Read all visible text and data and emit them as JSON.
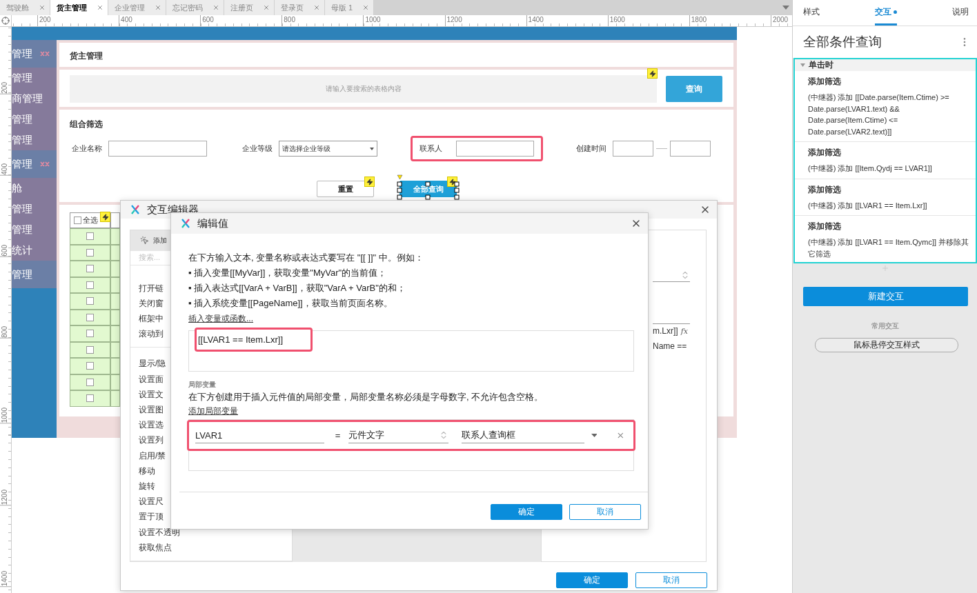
{
  "document_tabs": [
    {
      "label": "驾驶舱",
      "selected": false
    },
    {
      "label": "货主管理",
      "selected": true
    },
    {
      "label": "企业管理",
      "selected": false
    },
    {
      "label": "忘记密码",
      "selected": false
    },
    {
      "label": "注册页",
      "selected": false
    },
    {
      "label": "登录页",
      "selected": false
    },
    {
      "label": "母版 1",
      "selected": false
    }
  ],
  "ruler": {
    "horizontal": [
      "200",
      "400",
      "600",
      "800",
      "1000",
      "1200",
      "1400",
      "1600",
      "1800",
      "2000"
    ],
    "vertical": [
      "200",
      "400",
      "600",
      "800",
      "1000",
      "1200",
      "1400"
    ]
  },
  "sidebar": [
    {
      "label": "管理",
      "kind": "section",
      "flagged": true
    },
    {
      "label": "管理",
      "kind": "item"
    },
    {
      "label": "商管理",
      "kind": "item"
    },
    {
      "label": "管理",
      "kind": "item"
    },
    {
      "label": "管理",
      "kind": "item"
    },
    {
      "label": "管理",
      "kind": "section",
      "flagged": true
    },
    {
      "label": "舱",
      "kind": "item"
    },
    {
      "label": "管理",
      "kind": "item"
    },
    {
      "label": "管理",
      "kind": "item"
    },
    {
      "label": "统计",
      "kind": "item"
    },
    {
      "label": "管理",
      "kind": "section",
      "flagged": false
    }
  ],
  "page": {
    "title": "货主管理",
    "search": {
      "placeholder": "请输入要搜索的表格内容",
      "button": "查询"
    },
    "filter": {
      "title": "组合筛选",
      "fields": [
        {
          "label": "企业名称",
          "kind": "input",
          "highlighted": false
        },
        {
          "label": "企业等级",
          "kind": "select",
          "value": "请选择企业等级",
          "highlighted": false
        },
        {
          "label": "联系人",
          "kind": "input",
          "highlighted": true
        },
        {
          "label": "创建时间",
          "kind": "range",
          "highlighted": false
        }
      ],
      "buttons": [
        {
          "label": "重置",
          "selected": false
        },
        {
          "label": "全部查询",
          "selected": true
        }
      ]
    },
    "table": {
      "select_all": {
        "label": "全选",
        "checked": false
      },
      "rows": [
        {
          "checked": false
        },
        {
          "checked": false
        },
        {
          "checked": false
        },
        {
          "checked": false
        },
        {
          "checked": false
        },
        {
          "checked": false
        },
        {
          "checked": false
        },
        {
          "checked": false
        },
        {
          "checked": false
        },
        {
          "checked": false
        },
        {
          "checked": false
        }
      ]
    }
  },
  "interaction_editor": {
    "title": "交互编辑器",
    "action_panel": {
      "header": "添加",
      "search_placeholder": "搜索...",
      "groups": [
        [
          "打开链",
          "关闭窗",
          "框架中",
          "滚动到"
        ],
        [
          "显示/隐",
          "设置面",
          "设置文",
          "设置图",
          "设置选",
          "设置列",
          "启用/禁",
          "移动",
          "旋转",
          "设置尺",
          "置于顶",
          "设置不透明",
          "获取焦点"
        ]
      ]
    },
    "detail_texts": [
      "m.Lxr]]",
      "Name =="
    ],
    "formula_button": "fx",
    "buttons": [
      {
        "label": "确定",
        "kind": "primary"
      },
      {
        "label": "取消",
        "kind": "secondary"
      }
    ]
  },
  "edit_value": {
    "title": "编辑值",
    "intro": "在下方输入文本, 变量名称或表达式要写在 \"[[ ]]\" 中。例如：",
    "bullets": [
      "▪ 插入变量[[MyVar]]，获取变量\"MyVar\"的当前值；",
      "▪ 插入表达式[[VarA + VarB]]，获取\"VarA + VarB\"的和；",
      "▪ 插入系统变量[[PageName]]，获取当前页面名称。"
    ],
    "insert_link": "插入变量或函数...",
    "expression": {
      "text": "[[LVAR1 == Item.Lxr]]",
      "highlighted": true
    },
    "local_title": "局部变量",
    "local_description": "在下方创建用于插入元件值的局部变量，局部变量名称必须是字母数字, 不允许包含空格。",
    "add_link": "添加局部变量",
    "variables": [
      {
        "name": "LVAR1",
        "operator": "=",
        "type": "元件文字",
        "target": "联系人查询框",
        "highlighted": true
      }
    ],
    "buttons": [
      {
        "label": "确定",
        "kind": "primary"
      },
      {
        "label": "取消",
        "kind": "secondary"
      }
    ]
  },
  "inspector": {
    "tabs": [
      {
        "label": "样式",
        "selected": false,
        "modified": false
      },
      {
        "label": "交互",
        "selected": true,
        "modified": true
      },
      {
        "label": "说明",
        "selected": false,
        "modified": false
      }
    ],
    "widget_name": "全部条件查询",
    "event": {
      "label": "单击时",
      "expanded": true,
      "actions": [
        {
          "title": "添加筛选",
          "description": "(中继器) 添加 [[Date.parse(Item.Ctime) >= Date.parse(LVAR1.text) && Date.parse(Item.Ctime) <= Date.parse(LVAR2.text)]]"
        },
        {
          "title": "添加筛选",
          "description": "(中继器) 添加 [[Item.Qydj == LVAR1]]"
        },
        {
          "title": "添加筛选",
          "description": "(中继器) 添加 [[LVAR1 == Item.Lxr]]"
        },
        {
          "title": "添加筛选",
          "description": "(中继器) 添加 [[LVAR1 == Item.Qymc]] 并移除其它筛选"
        }
      ]
    },
    "new_button": "新建交互",
    "common_title": "常用交互",
    "common_actions": [
      "鼠标悬停交互样式"
    ]
  }
}
